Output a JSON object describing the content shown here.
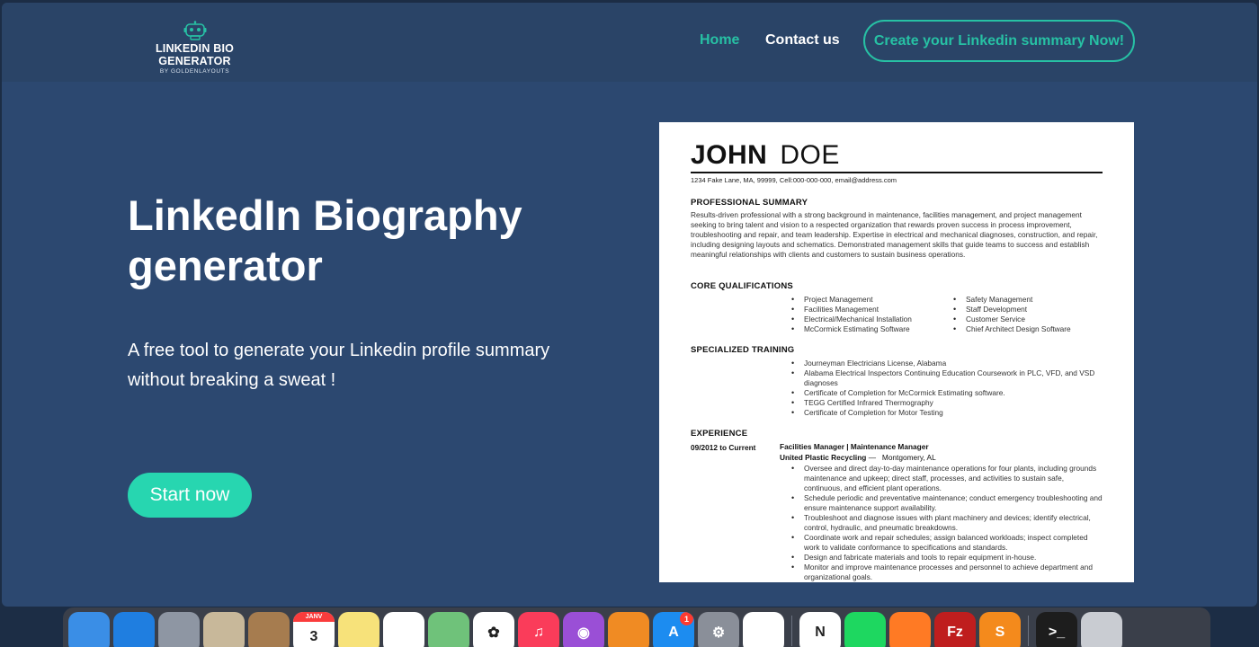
{
  "brand": {
    "title": "LINKEDIN BIO GENERATOR",
    "subtitle": "BY GOLDENLAYOUTS"
  },
  "nav": {
    "home": "Home",
    "contact": "Contact us",
    "cta": "Create your Linkedin summary Now!"
  },
  "hero": {
    "title": "LinkedIn Biography generator",
    "subtitle": "A free tool to generate your Linkedin profile summary without breaking a sweat !",
    "start": "Start now"
  },
  "resume": {
    "first": "JOHN",
    "last": "DOE",
    "contact": "1234 Fake Lane, MA, 99999, Cell:000-000-000, email@address.com",
    "summary_h": "PROFESSIONAL SUMMARY",
    "summary": "Results-driven professional with a strong background in maintenance, facilities management, and project management seeking to bring talent and vision to a respected organization that rewards proven success in process improvement, troubleshooting and repair, and team leadership. Expertise in electrical and mechanical diagnoses, construction, and repair, including designing layouts and schematics. Demonstrated management skills that guide teams to success and establish meaningful relationships with clients and customers to sustain business operations.",
    "core_h": "CORE QUALIFICATIONS",
    "core_left": [
      "Project Management",
      "Facilities Management",
      "Electrical/Mechanical Installation",
      "McCormick Estimating Software"
    ],
    "core_right": [
      "Safety Management",
      "Staff Development",
      "Customer Service",
      "Chief Architect Design Software"
    ],
    "training_h": "SPECIALIZED TRAINING",
    "training": [
      "Journeyman Electricians License, Alabama",
      "Alabama Electrical Inspectors Continuing Education Coursework in PLC, VFD, and VSD diagnoses",
      "Certificate of Completion for McCormick Estimating software.",
      "TEGG Certified Infrared Thermography",
      "Certificate of Completion for Motor Testing"
    ],
    "exp_h": "EXPERIENCE",
    "exp_date": "09/2012 to Current",
    "exp_title": "Facilities Manager | Maintenance Manager",
    "exp_company": "United Plastic Recycling",
    "exp_sep": "—",
    "exp_location": "Montgomery, AL",
    "exp_items": [
      "Oversee and direct day-to-day maintenance operations for four plants, including grounds maintenance and upkeep; direct staff, processes, and activities to sustain safe, continuous, and efficient plant operations.",
      "Schedule periodic and preventative maintenance; conduct emergency troubleshooting and ensure maintenance support availability.",
      "Troubleshoot and diagnose issues with plant machinery and devices; identify electrical, control, hydraulic, and pneumatic breakdowns.",
      "Coordinate work and repair schedules; assign balanced workloads; inspect completed work to validate conformance to specifications and standards.",
      "Design and fabricate materials and tools to repair equipment in-house.",
      "Monitor and improve maintenance processes and personnel to achieve department and organizational goals."
    ]
  },
  "dock": {
    "apps": [
      {
        "name": "finder-icon",
        "color": "#3a8ee6",
        "glyph": ""
      },
      {
        "name": "safari-icon",
        "color": "#1f7ee0",
        "glyph": ""
      },
      {
        "name": "launchpad-icon",
        "color": "#8e96a3",
        "glyph": ""
      },
      {
        "name": "mail-stamp-icon",
        "color": "#c8b89a",
        "glyph": ""
      },
      {
        "name": "contacts-icon",
        "color": "#a67c4f",
        "glyph": ""
      },
      {
        "name": "calendar-icon",
        "color": "#ffffff",
        "glyph": "3",
        "label": "JANV"
      },
      {
        "name": "notes-icon",
        "color": "#f7e27a",
        "glyph": ""
      },
      {
        "name": "reminders-icon",
        "color": "#ffffff",
        "glyph": ""
      },
      {
        "name": "maps-icon",
        "color": "#6fc27a",
        "glyph": ""
      },
      {
        "name": "photos-icon",
        "color": "#ffffff",
        "glyph": "✿"
      },
      {
        "name": "music-icon",
        "color": "#fa3c5a",
        "glyph": "♫"
      },
      {
        "name": "podcasts-icon",
        "color": "#9a4fd6",
        "glyph": "◉"
      },
      {
        "name": "books-icon",
        "color": "#f08b23",
        "glyph": ""
      },
      {
        "name": "app-store-icon",
        "color": "#1c8cf0",
        "glyph": "A",
        "badge": "1"
      },
      {
        "name": "system-preferences-icon",
        "color": "#8a8f99",
        "glyph": "⚙"
      },
      {
        "name": "chrome-icon",
        "color": "#ffffff",
        "glyph": ""
      },
      {
        "name": "notion-icon",
        "color": "#ffffff",
        "glyph": "N"
      },
      {
        "name": "spotify-icon",
        "color": "#1ed760",
        "glyph": ""
      },
      {
        "name": "firefox-icon",
        "color": "#ff7a24",
        "glyph": ""
      },
      {
        "name": "filezilla-icon",
        "color": "#bf1e1e",
        "glyph": "Fz"
      },
      {
        "name": "sublime-text-icon",
        "color": "#f48a1c",
        "glyph": "S"
      },
      {
        "name": "terminal-icon",
        "color": "#1d1d1d",
        "glyph": ">_"
      },
      {
        "name": "trash-icon",
        "color": "#c9ccd2",
        "glyph": ""
      }
    ]
  }
}
